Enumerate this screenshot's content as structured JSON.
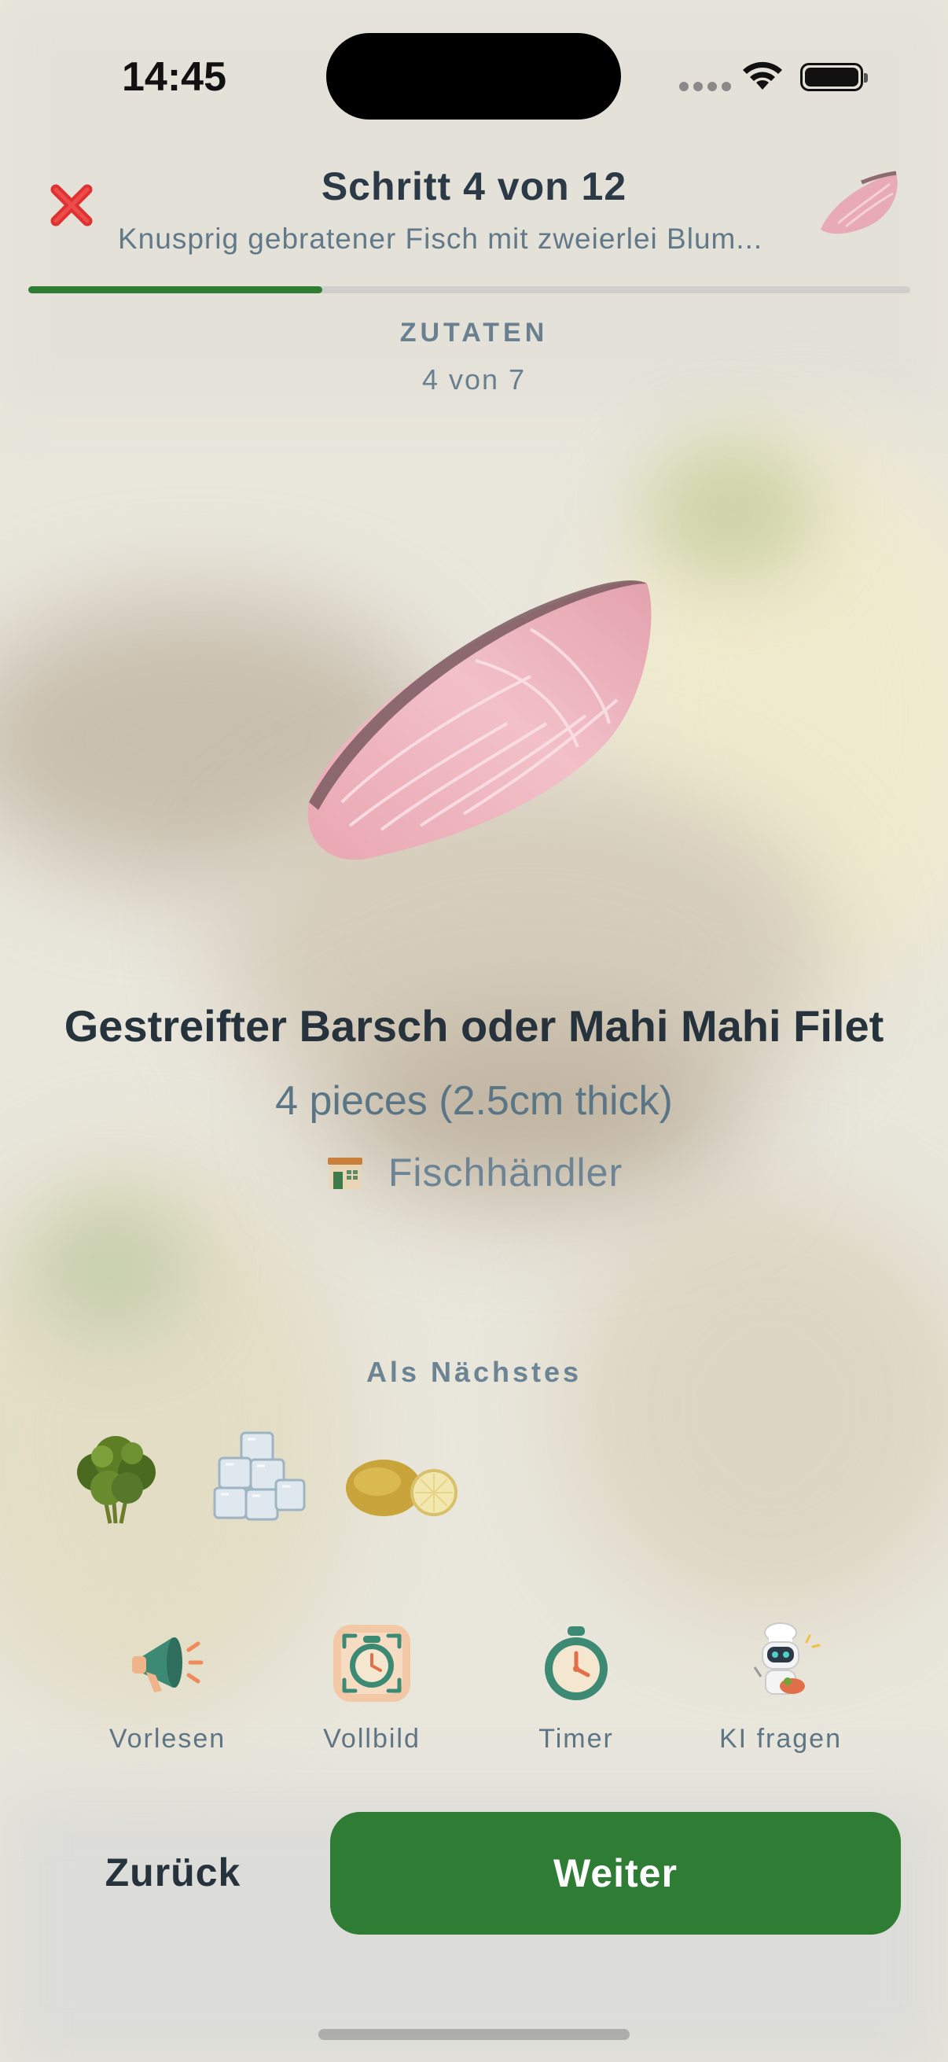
{
  "status_bar": {
    "time": "14:45"
  },
  "header": {
    "step_title": "Schritt 4 von 12",
    "recipe_name": "Knusprig gebratener Fisch mit zweierlei Blum...",
    "progress": 0.3333
  },
  "section": {
    "label": "ZUTATEN",
    "count": "4 von 7"
  },
  "ingredient": {
    "name": "Gestreifter Barsch oder Mahi Mahi Filet",
    "quantity": "4 pieces (2.5cm thick)",
    "shop": "Fischhändler",
    "shop_icon": "store-icon",
    "image": "fish-fillet-image"
  },
  "next_up": {
    "label": "Als Nächstes",
    "items": [
      {
        "image": "parsley-image"
      },
      {
        "image": "ice-cubes-image"
      },
      {
        "image": "lemon-image"
      }
    ]
  },
  "tools": [
    {
      "label": "Vorlesen",
      "icon": "megaphone-icon"
    },
    {
      "label": "Vollbild",
      "icon": "fullscreen-clock-icon"
    },
    {
      "label": "Timer",
      "icon": "stopwatch-icon"
    },
    {
      "label": "KI fragen",
      "icon": "robot-chef-icon"
    }
  ],
  "buttons": {
    "back": "Zurück",
    "next": "Weiter"
  },
  "colors": {
    "accent": "#2f7d34",
    "close": "#e03131",
    "text_dark": "#26333d",
    "text_muted": "#6c8494"
  }
}
